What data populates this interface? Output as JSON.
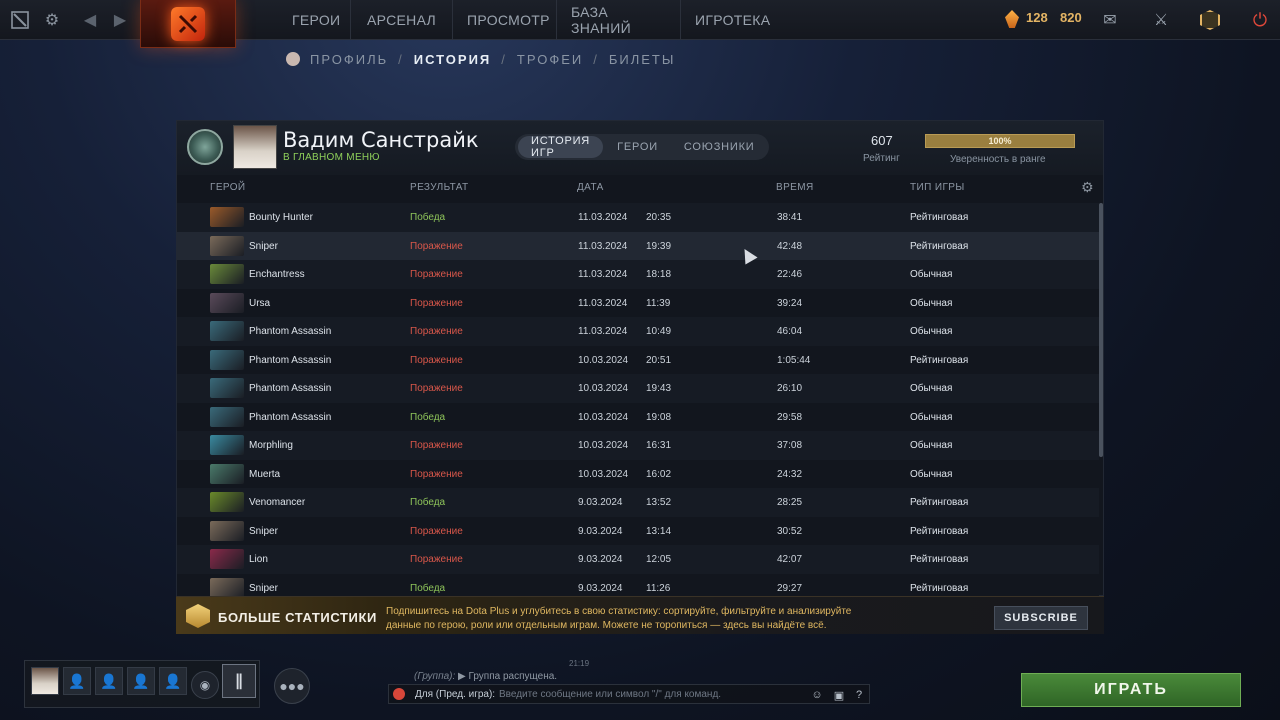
{
  "topbar": {
    "nav": [
      "ГЕРОИ",
      "АРСЕНАЛ",
      "ПРОСМОТР",
      "БАЗА ЗНАНИЙ",
      "ИГРОТЕКА"
    ],
    "currency_shards": "128",
    "currency_gold": "820"
  },
  "breadcrumb": [
    "ПРОФИЛЬ",
    "ИСТОРИЯ",
    "ТРОФЕИ",
    "БИЛЕТЫ"
  ],
  "profile": {
    "name": "Вадим Санстрайк",
    "status": "В ГЛАВНОМ МЕНЮ",
    "tabs": [
      "ИСТОРИЯ ИГР",
      "ГЕРОИ",
      "СОЮЗНИКИ"
    ],
    "rating_value": "607",
    "rating_label": "Рейтинг",
    "confidence_value": "100%",
    "confidence_label": "Уверенность в ранге"
  },
  "table": {
    "columns": [
      "ГЕРОЙ",
      "РЕЗУЛЬТАТ",
      "ДАТА",
      "ВРЕМЯ",
      "ТИП ИГРЫ"
    ],
    "rows": [
      {
        "hero": "Bounty Hunter",
        "result": "Победа",
        "win": true,
        "date": "11.03.2024",
        "time": "20:35",
        "duration": "38:41",
        "type": "Рейтинговая",
        "color": "#9a5a2a"
      },
      {
        "hero": "Sniper",
        "result": "Поражение",
        "win": false,
        "date": "11.03.2024",
        "time": "19:39",
        "duration": "42:48",
        "type": "Рейтинговая",
        "color": "#7a6a5a"
      },
      {
        "hero": "Enchantress",
        "result": "Поражение",
        "win": false,
        "date": "11.03.2024",
        "time": "18:18",
        "duration": "22:46",
        "type": "Обычная",
        "color": "#6a8a3a"
      },
      {
        "hero": "Ursa",
        "result": "Поражение",
        "win": false,
        "date": "11.03.2024",
        "time": "11:39",
        "duration": "39:24",
        "type": "Обычная",
        "color": "#5a4a5a"
      },
      {
        "hero": "Phantom Assassin",
        "result": "Поражение",
        "win": false,
        "date": "11.03.2024",
        "time": "10:49",
        "duration": "46:04",
        "type": "Обычная",
        "color": "#3a6a7a"
      },
      {
        "hero": "Phantom Assassin",
        "result": "Поражение",
        "win": false,
        "date": "10.03.2024",
        "time": "20:51",
        "duration": "1:05:44",
        "type": "Рейтинговая",
        "color": "#3a6a7a"
      },
      {
        "hero": "Phantom Assassin",
        "result": "Поражение",
        "win": false,
        "date": "10.03.2024",
        "time": "19:43",
        "duration": "26:10",
        "type": "Обычная",
        "color": "#3a6a7a"
      },
      {
        "hero": "Phantom Assassin",
        "result": "Победа",
        "win": true,
        "date": "10.03.2024",
        "time": "19:08",
        "duration": "29:58",
        "type": "Обычная",
        "color": "#3a6a7a"
      },
      {
        "hero": "Morphling",
        "result": "Поражение",
        "win": false,
        "date": "10.03.2024",
        "time": "16:31",
        "duration": "37:08",
        "type": "Обычная",
        "color": "#3a8aa0"
      },
      {
        "hero": "Muerta",
        "result": "Поражение",
        "win": false,
        "date": "10.03.2024",
        "time": "16:02",
        "duration": "24:32",
        "type": "Обычная",
        "color": "#4a7a6a"
      },
      {
        "hero": "Venomancer",
        "result": "Победа",
        "win": true,
        "date": "9.03.2024",
        "time": "13:52",
        "duration": "28:25",
        "type": "Рейтинговая",
        "color": "#6a8a2a"
      },
      {
        "hero": "Sniper",
        "result": "Поражение",
        "win": false,
        "date": "9.03.2024",
        "time": "13:14",
        "duration": "30:52",
        "type": "Рейтинговая",
        "color": "#7a6a5a"
      },
      {
        "hero": "Lion",
        "result": "Поражение",
        "win": false,
        "date": "9.03.2024",
        "time": "12:05",
        "duration": "42:07",
        "type": "Рейтинговая",
        "color": "#8a2a4a"
      },
      {
        "hero": "Sniper",
        "result": "Победа",
        "win": true,
        "date": "9.03.2024",
        "time": "11:26",
        "duration": "29:27",
        "type": "Рейтинговая",
        "color": "#7a6a5a"
      }
    ]
  },
  "plus_banner": {
    "title": "БОЛЬШЕ СТАТИСТИКИ",
    "text": "Подпишитесь на Dota Plus и углубитесь в свою статистику: сортируйте, фильтруйте и анализируйте данные по герою, роли или отдельным играм. Можете не торопиться — здесь вы найдёте всё.",
    "button": "SUBSCRIBE"
  },
  "chat": {
    "time": "21:19",
    "group_tag": "(Группа):",
    "message": "Группа распущена.",
    "channel": "Для (Пред. игра):",
    "placeholder": "Введите сообщение или символ \"/\" для команд."
  },
  "play_button": "ИГРАТЬ",
  "colors": {
    "accent_gold": "#e3b464",
    "win": "#8ec45a",
    "loss": "#d9574a",
    "play_green": "#3f7d32"
  }
}
